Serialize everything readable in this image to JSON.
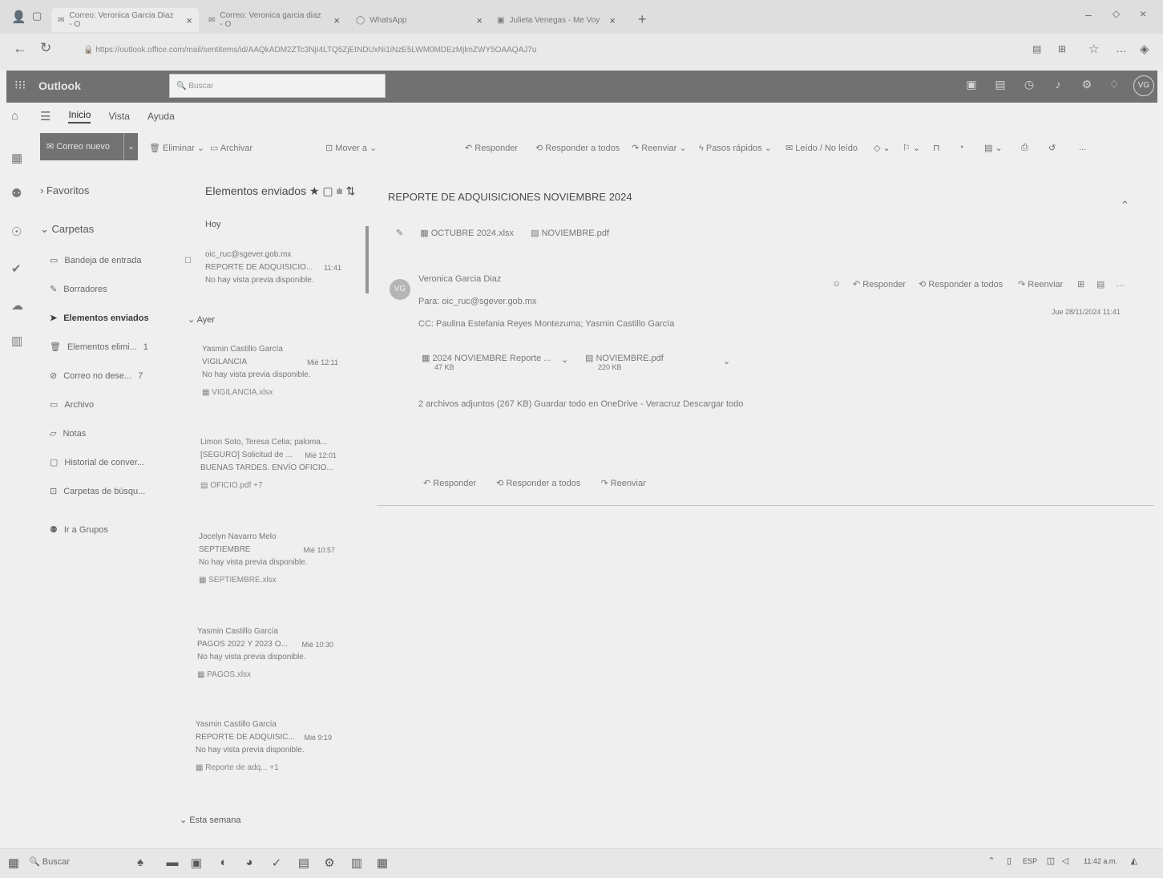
{
  "browser": {
    "tabs": [
      {
        "title": "Correo: Veronica Garcia Diaz - O",
        "close": "×"
      },
      {
        "title": "Correo: Veronica garcia diaz - O",
        "close": "×"
      },
      {
        "title": "WhatsApp",
        "close": "×"
      },
      {
        "title": "Julieta Venegas - Me Voy",
        "close": "×"
      }
    ],
    "new_tab": "+",
    "url": "https://outlook.office.com/mail/sentitems/id/AAQkADM2ZTc3NjI4LTQ5ZjEtNDUxNi1iNzE5LWM0MDEzMjlmZWY5OAAQAJ7u"
  },
  "outlook": {
    "app_name": "Outlook",
    "search_placeholder": "Buscar",
    "avatar": "VG"
  },
  "ribbon": {
    "tabs": [
      "Inicio",
      "Vista",
      "Ayuda"
    ]
  },
  "toolbar": {
    "new_mail": "Correo nuevo",
    "delete": "Eliminar",
    "archive": "Archivar",
    "move": "Mover a",
    "reply": "Responder",
    "reply_all": "Responder a todos",
    "forward": "Reenviar",
    "quick_steps": "Pasos rápidos",
    "read_unread": "Leído / No leído",
    "more": "..."
  },
  "folders": {
    "favorites": "Favoritos",
    "folders_header": "Carpetas",
    "items": [
      {
        "label": "Bandeja de entrada",
        "count": ""
      },
      {
        "label": "Borradores",
        "count": ""
      },
      {
        "label": "Elementos enviados",
        "count": ""
      },
      {
        "label": "Elementos elimi...",
        "count": "1"
      },
      {
        "label": "Correo no dese...",
        "count": "7"
      },
      {
        "label": "Archivo",
        "count": ""
      },
      {
        "label": "Notas",
        "count": ""
      },
      {
        "label": "Historial de conver...",
        "count": ""
      },
      {
        "label": "Carpetas de búsqu...",
        "count": ""
      }
    ],
    "groups": "Ir a Grupos"
  },
  "msglist": {
    "title": "Elementos enviados",
    "today": "Hoy",
    "yesterday": "Ayer",
    "this_week": "Esta semana",
    "messages": [
      {
        "from": "oic_ruc@sgever.gob.mx",
        "subject": "REPORTE DE ADQUISICIO...",
        "time": "11:41",
        "preview": "No hay vista previa disponible.",
        "attach": ""
      },
      {
        "from": "Yasmin Castillo García",
        "subject": "VIGILANCIA",
        "time": "Mié 12:11",
        "preview": "No hay vista previa disponible.",
        "attach": "VIGILANCIA.xlsx"
      },
      {
        "from": "Limon Soto, Teresa Celia; paloma...",
        "subject": "[SEGURO] Solicitud de ...",
        "time": "Mié 12:01",
        "preview": "BUENAS TARDES. ENVÍO OFICIO...",
        "attach": "OFICIO.pdf  +7"
      },
      {
        "from": "Jocelyn Navarro Melo",
        "subject": "SEPTIEMBRE",
        "time": "Mié 10:57",
        "preview": "No hay vista previa disponible.",
        "attach": "SEPTIEMBRE.xlsx"
      },
      {
        "from": "Yasmin Castillo García",
        "subject": "PAGOS 2022 Y 2023 O...",
        "time": "Mié 10:30",
        "preview": "No hay vista previa disponible.",
        "attach": "PAGOS.xlsx"
      },
      {
        "from": "Yasmin Castillo García",
        "subject": "REPORTE DE ADQUISIC...",
        "time": "Mié 9:19",
        "preview": "No hay vista previa disponible.",
        "attach": "Reporte de adq...  +1"
      }
    ]
  },
  "reader": {
    "subject": "REPORTE DE ADQUISICIONES NOVIEMBRE 2024",
    "top_attachments": [
      "OCTUBRE 2024.xlsx",
      "NOVIEMBRE.pdf"
    ],
    "sender_avatar": "VG",
    "sender": "Veronica Garcia Diaz",
    "to": "Para: oic_ruc@sgever.gob.mx",
    "cc": "CC: Paulina Estefania Reyes Montezuma; Yasmin Castillo García",
    "date": "Jue 28/11/2024 11:41",
    "attachments": [
      {
        "name": "2024 NOVIEMBRE Reporte ...",
        "size": "47 KB"
      },
      {
        "name": "NOVIEMBRE.pdf",
        "size": "220 KB"
      }
    ],
    "attach_summary": "2 archivos adjuntos (267 KB)   Guardar todo en OneDrive - Veracruz   Descargar todo",
    "reply": "Responder",
    "reply_all": "Responder a todos",
    "forward": "Reenviar"
  },
  "taskbar": {
    "search": "Buscar",
    "lang": "ESP",
    "time": "11:42 a.m."
  }
}
